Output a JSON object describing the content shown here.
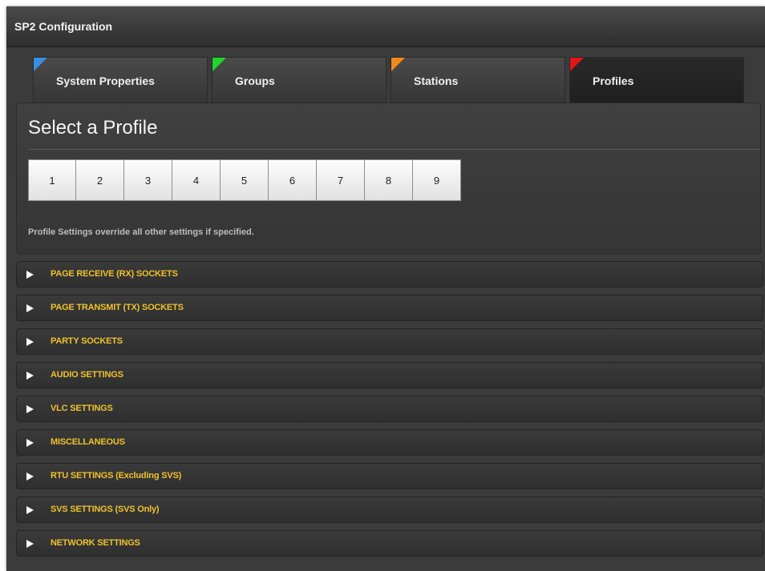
{
  "window": {
    "title": "SP2 Configuration"
  },
  "tabs": [
    {
      "label": "System Properties",
      "flag_color": "#3a8fe0",
      "active": false
    },
    {
      "label": "Groups",
      "flag_color": "#1fd62b",
      "active": false
    },
    {
      "label": "Stations",
      "flag_color": "#f08a1c",
      "active": false
    },
    {
      "label": "Profiles",
      "flag_color": "#e01515",
      "active": true
    }
  ],
  "profile_panel": {
    "heading": "Select a Profile",
    "buttons": [
      "1",
      "2",
      "3",
      "4",
      "5",
      "6",
      "7",
      "8",
      "9"
    ],
    "note": "Profile Settings override all other settings if specified."
  },
  "sections": [
    "PAGE RECEIVE (RX) SOCKETS",
    "PAGE TRANSMIT (TX) SOCKETS",
    "PARTY SOCKETS",
    "AUDIO SETTINGS",
    "VLC SETTINGS",
    "MISCELLANEOUS",
    "RTU SETTINGS (Excluding SVS)",
    "SVS SETTINGS (SVS Only)",
    "NETWORK SETTINGS"
  ],
  "colors": {
    "section_label": "#f0c12c",
    "panel_background": "#3b3b3b"
  }
}
